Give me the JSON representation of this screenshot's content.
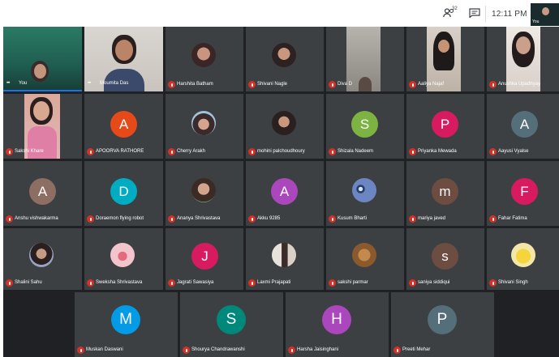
{
  "topbar": {
    "people_count": "32",
    "clock": "12:11 PM",
    "self_label": "You"
  },
  "video_tiles": {
    "you": "You",
    "moumita": "Moumita Das"
  },
  "participants": {
    "row1": [
      "Harshita Batham",
      "Shivani Nagle",
      "Diva D",
      "Aaliya Najaf",
      "Anushka Upadhyay"
    ],
    "row2": [
      "Sakshi Khare",
      "APOORVA RATHORE",
      "Cherry Arakh",
      "mohini palchoudhoury",
      "Shizala Nadeem",
      "Priyanka Mewada",
      "Aayusi Vyalse"
    ],
    "row3": [
      "Anshu vishwakarma",
      "Doraemon flying robot",
      "Ananya Shrivastava",
      "Akku 9285",
      "Kusum Bharti",
      "mariya javed",
      "Fahar Fatima"
    ],
    "row4": [
      "Shalini Sahu",
      "Sweksha Shrivastava",
      "Jagrati Sawasiya",
      "Laxmi Prajapati",
      "sakshi parmar",
      "saniya siddiqui",
      "Shivani Singh"
    ],
    "row5": [
      "Muskan Daswani",
      "Shourya Chandrawanshi",
      "Harsha Jaisinghani",
      "Preeti Mehar"
    ]
  },
  "initials": {
    "apoorva": "A",
    "shizala": "S",
    "priyanka": "P",
    "aayusi": "A",
    "anshu": "A",
    "doraemon": "D",
    "akku": "A",
    "mariya": "m",
    "fahar": "F",
    "jagrati": "J",
    "saniya": "s",
    "muskan": "M",
    "shourya": "S",
    "harsha": "H",
    "preeti": "P"
  },
  "colors": {
    "stage": "#202124",
    "tile": "#3c4043",
    "mic_off": "#d93025"
  }
}
